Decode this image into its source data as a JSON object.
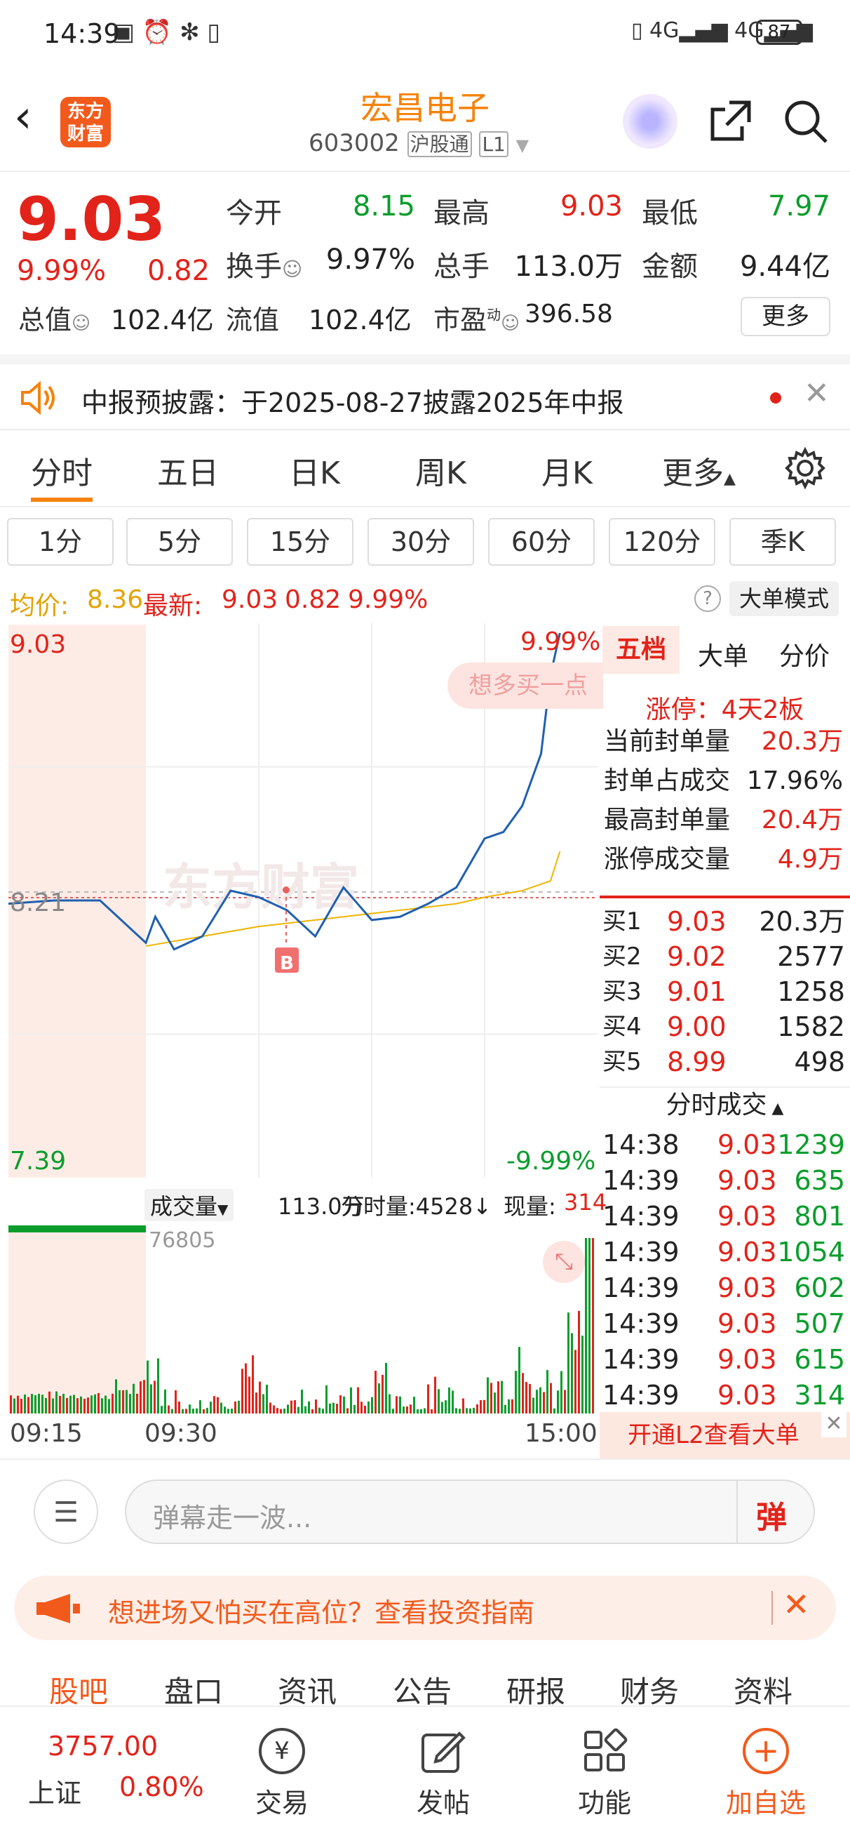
{
  "status_bar": {
    "time": "14:39",
    "battery": "87"
  },
  "header": {
    "logo_line1": "东方",
    "logo_line2": "财富",
    "stock_name": "宏昌电子",
    "stock_code": "603002",
    "badge_hgt": "沪股通",
    "badge_level": "L1"
  },
  "quote": {
    "price": "9.03",
    "change_pct": "9.99%",
    "change_amt": "0.82",
    "open_label": "今开",
    "open": "8.15",
    "high_label": "最高",
    "high": "9.03",
    "low_label": "最低",
    "low": "7.97",
    "turnover_label": "换手",
    "turnover": "9.97%",
    "volume_label": "总手",
    "volume": "113.0万",
    "amount_label": "金额",
    "amount": "9.44亿",
    "mcap_label": "总值",
    "mcap": "102.4亿",
    "float_label": "流值",
    "float_value": "102.4亿",
    "pe_label": "市盈",
    "pe_sup": "动",
    "pe": "396.58",
    "more_label": "更多"
  },
  "notice": {
    "text": "中报预披露：于2025-08-27披露2025年中报"
  },
  "tabs": [
    "分时",
    "五日",
    "日K",
    "周K",
    "月K",
    "更多"
  ],
  "periods": [
    "1分",
    "5分",
    "15分",
    "30分",
    "60分",
    "120分",
    "季K"
  ],
  "info_row": {
    "avg_label": "均价:",
    "avg": "8.36",
    "latest_label": "最新:",
    "latest": "9.03",
    "latest_chg": "0.82",
    "latest_pct": "9.99%",
    "mode_label": "大单模式"
  },
  "chart_labels": {
    "top_price": "9.03",
    "top_pct": "9.99%",
    "mid_price": "8.21",
    "bottom_price": "7.39",
    "bottom_pct": "-9.99%",
    "buy_tip": "想多买一点",
    "marker": "B"
  },
  "volume_bar": {
    "label": "成交量",
    "total": "113.0万",
    "minute_label": "分时量:4528↓",
    "current_label": "现量:",
    "current": "314",
    "peak": "76805"
  },
  "time_axis": [
    "09:15",
    "09:30",
    "15:00"
  ],
  "right_tabs": [
    "五档",
    "大单",
    "分价"
  ],
  "limit_info": {
    "title": "涨停：4天2板",
    "rows": [
      {
        "label": "当前封单量",
        "value": "20.3万",
        "color": "red"
      },
      {
        "label": "封单占成交",
        "value": "17.96%",
        "color": "black"
      },
      {
        "label": "最高封单量",
        "value": "20.4万",
        "color": "red"
      },
      {
        "label": "涨停成交量",
        "value": "4.9万",
        "color": "red"
      }
    ]
  },
  "order_book": [
    {
      "label": "买1",
      "price": "9.03",
      "vol": "20.3万"
    },
    {
      "label": "买2",
      "price": "9.02",
      "vol": "2577"
    },
    {
      "label": "买3",
      "price": "9.01",
      "vol": "1258"
    },
    {
      "label": "买4",
      "price": "9.00",
      "vol": "1582"
    },
    {
      "label": "买5",
      "price": "8.99",
      "vol": "498"
    }
  ],
  "trades_title": "分时成交",
  "trades": [
    {
      "time": "14:38",
      "price": "9.03",
      "vol": "1239",
      "color": "green"
    },
    {
      "time": "14:39",
      "price": "9.03",
      "vol": "635",
      "color": "green"
    },
    {
      "time": "14:39",
      "price": "9.03",
      "vol": "801",
      "color": "green"
    },
    {
      "time": "14:39",
      "price": "9.03",
      "vol": "1054",
      "color": "green"
    },
    {
      "time": "14:39",
      "price": "9.03",
      "vol": "602",
      "color": "green"
    },
    {
      "time": "14:39",
      "price": "9.03",
      "vol": "507",
      "color": "green"
    },
    {
      "time": "14:39",
      "price": "9.03",
      "vol": "615",
      "color": "green"
    },
    {
      "time": "14:39",
      "price": "9.03",
      "vol": "314",
      "color": "green"
    }
  ],
  "l2_label": "开通L2查看大单",
  "comment": {
    "placeholder": "弹幕走一波...",
    "danmu": "弹"
  },
  "banner": {
    "text": "想进场又怕买在高位？查看投资指南"
  },
  "news_tabs": [
    "股吧",
    "盘口",
    "资讯",
    "公告",
    "研报",
    "财务",
    "资料"
  ],
  "bottom_nav": {
    "index_value": "3757.00",
    "index_name": "上证",
    "index_pct": "0.80%",
    "items": [
      "交易",
      "发帖",
      "功能",
      "加自选"
    ]
  },
  "chart_data": {
    "type": "line",
    "title": "",
    "xlabel": "",
    "ylabel": "",
    "x_range": [
      "09:15",
      "15:00"
    ],
    "ylim": [
      7.39,
      9.03
    ],
    "prev_close": 8.21,
    "series": [
      {
        "name": "",
        "x": [
          "09:15",
          "09:20",
          "09:25",
          "09:30",
          "09:35",
          "09:45",
          "10:00",
          "10:15",
          "10:30",
          "10:45",
          "11:00",
          "11:15",
          "11:30",
          "13:15",
          "13:30",
          "13:45",
          "14:00",
          "14:10",
          "14:20",
          "14:30",
          "14:35",
          "14:40"
        ],
        "values": [
          8.2,
          8.21,
          8.21,
          8.08,
          8.16,
          8.06,
          8.1,
          8.24,
          8.22,
          8.18,
          8.1,
          8.25,
          8.15,
          8.16,
          8.2,
          8.25,
          8.4,
          8.42,
          8.5,
          8.66,
          8.9,
          9.03
        ]
      },
      {
        "name": "",
        "x": [
          "09:30",
          "10:00",
          "10:30",
          "11:00",
          "11:30",
          "13:15",
          "13:45",
          "14:00",
          "14:20",
          "14:35",
          "14:40"
        ],
        "values": [
          8.07,
          8.1,
          8.13,
          8.15,
          8.17,
          8.18,
          8.2,
          8.22,
          8.24,
          8.27,
          8.36
        ]
      }
    ],
    "volume": {
      "peak": 76805,
      "unit": "手"
    }
  }
}
